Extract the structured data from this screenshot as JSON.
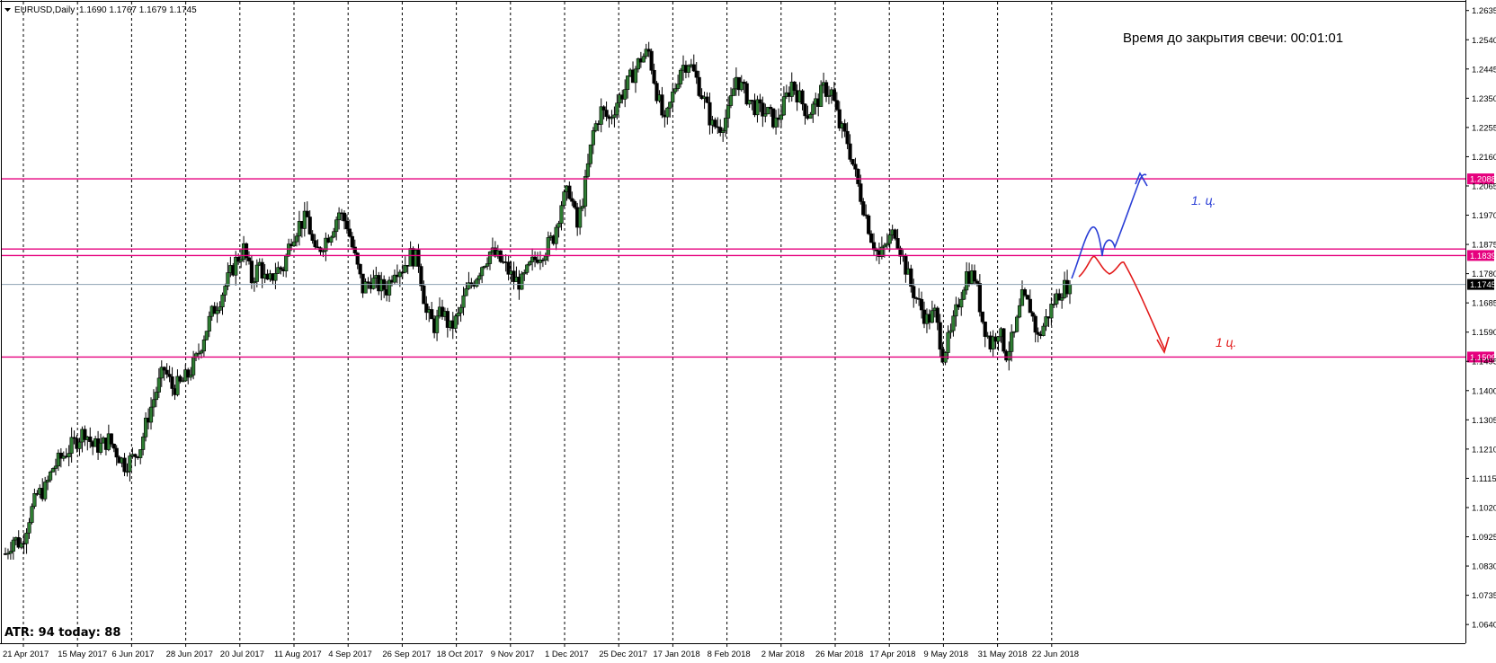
{
  "header": {
    "symbol_info": "EURUSD,Daily",
    "ohlc": "1.1690 1.1767 1.1679 1.1745"
  },
  "timer_text": "Время до закрытия свечи: 00:01:01",
  "atr_text": "ATR: 94  today: 88",
  "annotations": {
    "blue_note": "1. ц.",
    "red_note": "1 ц."
  },
  "colors": {
    "up_candle": "#2e7d32",
    "down_candle": "#000000",
    "level_line": "#e6007e",
    "current_price_line": "#8fa3b3",
    "blue_path": "#2b3fd6",
    "red_path": "#e21a1a"
  },
  "chart_data": {
    "type": "candlestick",
    "symbol": "EURUSD",
    "timeframe": "Daily",
    "ylim": [
      1.062,
      1.264
    ],
    "y_ticks": [
      "1.2635",
      "1.2540",
      "1.2445",
      "1.2350",
      "1.2255",
      "1.2160",
      "1.2065",
      "1.1970",
      "1.1875",
      "1.1780",
      "1.1685",
      "1.1590",
      "1.1495",
      "1.1400",
      "1.1305",
      "1.1210",
      "1.1115",
      "1.1020",
      "1.0925",
      "1.0830",
      "1.0735",
      "1.0640"
    ],
    "x_labels": [
      "21 Apr 2017",
      "15 May 2017",
      "6 Jun 2017",
      "28 Jun 2017",
      "20 Jul 2017",
      "11 Aug 2017",
      "4 Sep 2017",
      "26 Sep 2017",
      "18 Oct 2017",
      "9 Nov 2017",
      "1 Dec 2017",
      "25 Dec 2017",
      "17 Jan 2018",
      "8 Feb 2018",
      "2 Mar 2018",
      "26 Mar 2018",
      "17 Apr 2018",
      "9 May 2018",
      "31 May 2018",
      "22 Jun 2018"
    ],
    "price_levels": [
      {
        "value": 1.2088,
        "label": "1.2088"
      },
      {
        "value": 1.1839,
        "label": "1.1839"
      },
      {
        "value": 1.1509,
        "label": "1.1509"
      }
    ],
    "resistance_band": [
      1.1839,
      1.186
    ],
    "current_price": {
      "value": 1.1745,
      "label": "1.1745"
    },
    "close_path": [
      1.087,
      1.092,
      1.09,
      1.099,
      1.106,
      1.108,
      1.115,
      1.118,
      1.121,
      1.124,
      1.127,
      1.122,
      1.122,
      1.124,
      1.12,
      1.116,
      1.118,
      1.122,
      1.132,
      1.14,
      1.147,
      1.141,
      1.142,
      1.145,
      1.15,
      1.158,
      1.165,
      1.17,
      1.176,
      1.182,
      1.186,
      1.176,
      1.181,
      1.174,
      1.179,
      1.18,
      1.19,
      1.194,
      1.196,
      1.184,
      1.188,
      1.192,
      1.198,
      1.194,
      1.183,
      1.173,
      1.176,
      1.174,
      1.173,
      1.18,
      1.18,
      1.184,
      1.182,
      1.165,
      1.161,
      1.166,
      1.16,
      1.164,
      1.172,
      1.176,
      1.181,
      1.185,
      1.183,
      1.18,
      1.176,
      1.175,
      1.18,
      1.184,
      1.186,
      1.19,
      1.201,
      1.205,
      1.193,
      1.207,
      1.224,
      1.231,
      1.228,
      1.234,
      1.238,
      1.243,
      1.248,
      1.25,
      1.237,
      1.226,
      1.236,
      1.245,
      1.247,
      1.241,
      1.234,
      1.226,
      1.226,
      1.23,
      1.242,
      1.237,
      1.233,
      1.231,
      1.23,
      1.227,
      1.233,
      1.24,
      1.235,
      1.23,
      1.233,
      1.238,
      1.237,
      1.226,
      1.221,
      1.21,
      1.2,
      1.19,
      1.183,
      1.188,
      1.192,
      1.183,
      1.174,
      1.168,
      1.163,
      1.165,
      1.152,
      1.158,
      1.169,
      1.178,
      1.177,
      1.163,
      1.155,
      1.16,
      1.152,
      1.158,
      1.17,
      1.167,
      1.157,
      1.163,
      1.169,
      1.173,
      1.175
    ]
  }
}
